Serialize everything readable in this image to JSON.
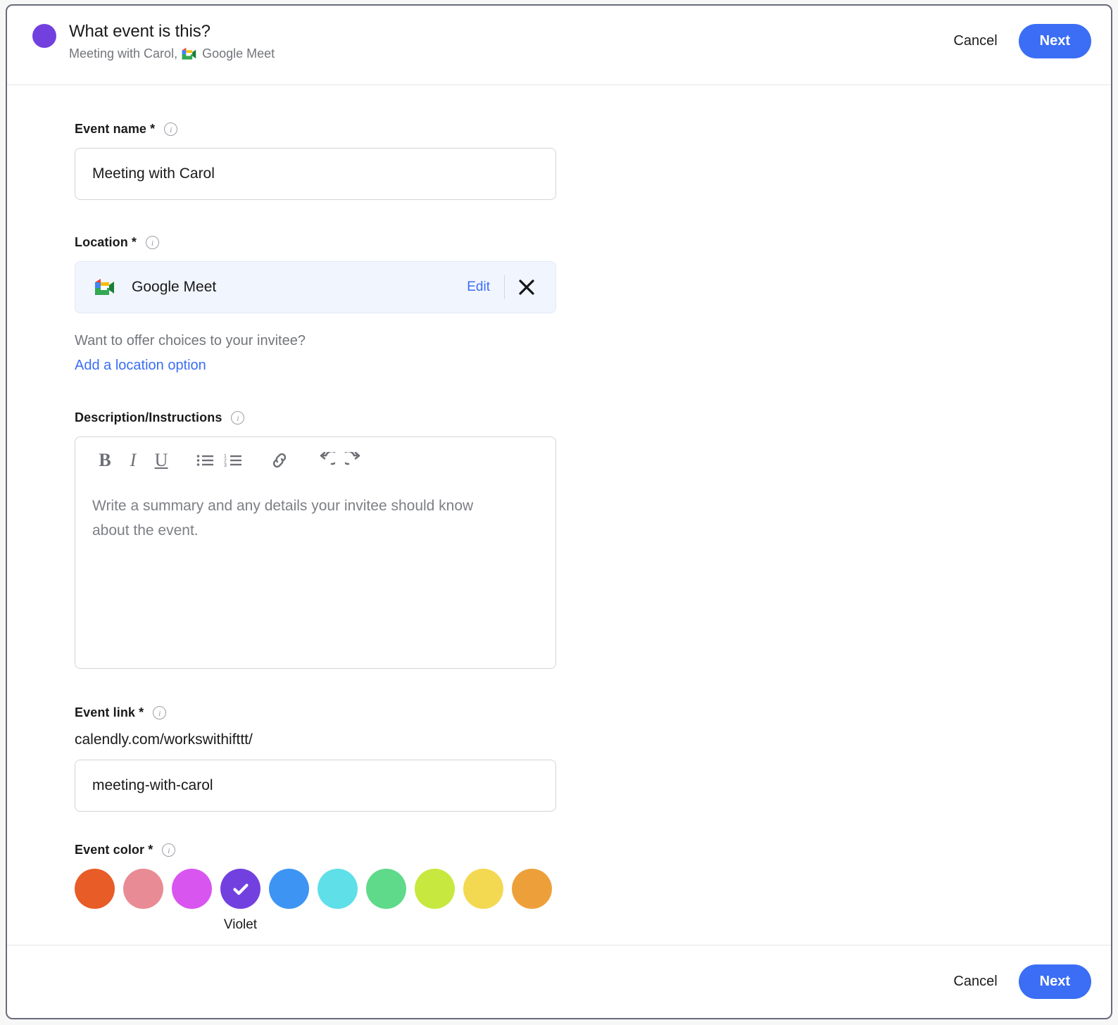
{
  "header": {
    "title": "What event is this?",
    "subtitle_prefix": "Meeting with Carol, ",
    "subtitle_location": "Google Meet",
    "cancel_label": "Cancel",
    "next_label": "Next",
    "avatar_color": "#7340e0"
  },
  "event_name": {
    "label": "Event name *",
    "value": "Meeting with Carol"
  },
  "location": {
    "label": "Location *",
    "name": "Google Meet",
    "edit_label": "Edit",
    "hint": "Want to offer choices to your invitee?",
    "add_option_label": "Add a location option"
  },
  "description": {
    "label": "Description/Instructions",
    "placeholder": "Write a summary and any details your invitee should know about the event.",
    "toolbar": {
      "bold": "B",
      "italic": "I",
      "underline": "U"
    }
  },
  "event_link": {
    "label": "Event link *",
    "url_prefix": "calendly.com/workswithifttt/",
    "slug": "meeting-with-carol"
  },
  "event_color": {
    "label": "Event color *",
    "selected_index": 3,
    "selected_name": "Violet",
    "swatches": [
      {
        "name": "Tomato",
        "hex": "#e85c28"
      },
      {
        "name": "Salmon",
        "hex": "#e98b95"
      },
      {
        "name": "Magenta",
        "hex": "#d955f0"
      },
      {
        "name": "Violet",
        "hex": "#7340e0"
      },
      {
        "name": "Blue",
        "hex": "#3d94f3"
      },
      {
        "name": "Turquoise",
        "hex": "#5fdfe8"
      },
      {
        "name": "Green",
        "hex": "#5fd98a"
      },
      {
        "name": "Lime",
        "hex": "#c7e83f"
      },
      {
        "name": "Yellow",
        "hex": "#f3d851"
      },
      {
        "name": "Orange",
        "hex": "#eda03a"
      }
    ]
  },
  "footer": {
    "cancel_label": "Cancel",
    "next_label": "Next"
  },
  "theme": {
    "accent_blue": "#3b6ef5",
    "link_blue": "#3b6ef5",
    "chip_bg": "#f1f5fe"
  }
}
